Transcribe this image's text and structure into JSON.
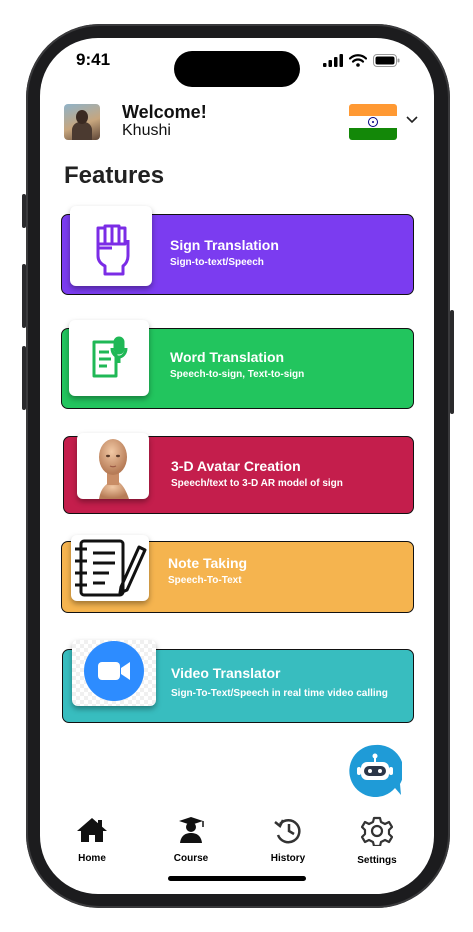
{
  "status_bar": {
    "time": "9:41"
  },
  "header": {
    "welcome": "Welcome!",
    "user_name": "Khushi"
  },
  "page_title": "Features",
  "features": [
    {
      "title": "Sign Translation",
      "subtitle": "Sign-to-text/Speech",
      "color": "#7b3cf0",
      "icon": "raised-fist-icon"
    },
    {
      "title": "Word Translation",
      "subtitle": "Speech-to-sign, Text-to-sign",
      "color": "#22c55e",
      "icon": "speech-to-text-icon"
    },
    {
      "title": "3-D Avatar Creation",
      "subtitle": "Speech/text to 3-D AR model of sign",
      "color": "#c41e4c",
      "icon": "3d-head-avatar-icon"
    },
    {
      "title": "Note Taking",
      "subtitle": "Speech-To-Text",
      "color": "#f5b44f",
      "icon": "notebook-pen-icon"
    },
    {
      "title": "Video Translator",
      "subtitle": "Sign-To-Text/Speech in real time video calling",
      "color": "#38bdbf",
      "icon": "video-camera-icon"
    }
  ],
  "nav": [
    {
      "label": "Home",
      "icon": "home-icon"
    },
    {
      "label": "Course",
      "icon": "graduate-icon"
    },
    {
      "label": "History",
      "icon": "history-icon"
    },
    {
      "label": "Settings",
      "icon": "settings-gear-icon"
    }
  ],
  "colors": {
    "india_saffron": "#ff9933",
    "india_green": "#138808",
    "chakra_blue": "#000080",
    "chatbot_blue": "#1f9bd7"
  }
}
